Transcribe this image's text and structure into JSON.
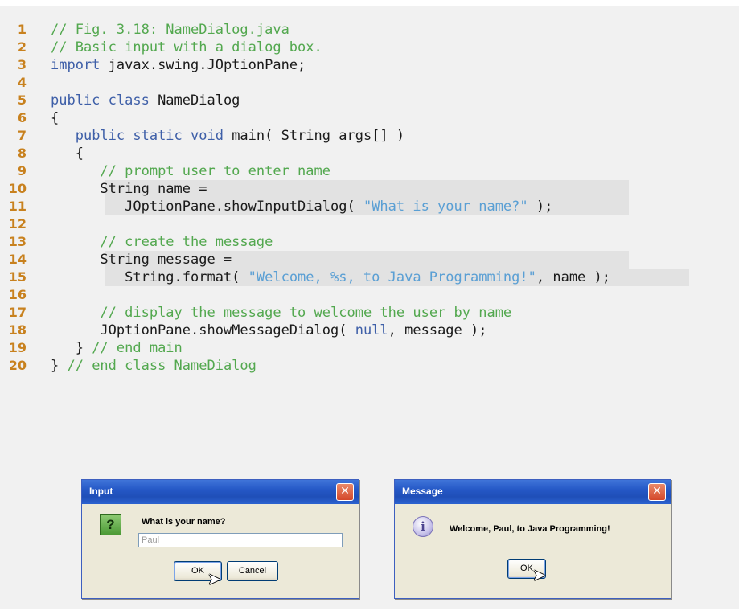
{
  "code": [
    {
      "n": "1",
      "tokens": [
        {
          "t": "// Fig. 3.18: NameDialog.java",
          "c": "cm"
        }
      ]
    },
    {
      "n": "2",
      "tokens": [
        {
          "t": "// Basic input with a dialog box.",
          "c": "cm"
        }
      ]
    },
    {
      "n": "3",
      "tokens": [
        {
          "t": "import",
          "c": "kw"
        },
        {
          "t": " javax.swing.JOptionPane;",
          "c": ""
        }
      ]
    },
    {
      "n": "4",
      "tokens": []
    },
    {
      "n": "5",
      "tokens": [
        {
          "t": "public class",
          "c": "kw"
        },
        {
          "t": " NameDialog",
          "c": ""
        }
      ]
    },
    {
      "n": "6",
      "tokens": [
        {
          "t": "{",
          "c": ""
        }
      ]
    },
    {
      "n": "7",
      "tokens": [
        {
          "t": "   ",
          "c": ""
        },
        {
          "t": "public static void",
          "c": "kw"
        },
        {
          "t": " main( String args[] )",
          "c": ""
        }
      ]
    },
    {
      "n": "8",
      "tokens": [
        {
          "t": "   {",
          "c": ""
        }
      ]
    },
    {
      "n": "9",
      "tokens": [
        {
          "t": "      ",
          "c": ""
        },
        {
          "t": "// prompt user to enter name",
          "c": "cm"
        }
      ]
    },
    {
      "n": "10",
      "hl": true,
      "tokens": [
        {
          "t": "      String name =",
          "c": ""
        }
      ]
    },
    {
      "n": "11",
      "hl": true,
      "tokens": [
        {
          "t": "         JOptionPane.showInputDialog( ",
          "c": ""
        },
        {
          "t": "\"What is your name?\"",
          "c": "st"
        },
        {
          "t": " );",
          "c": ""
        }
      ]
    },
    {
      "n": "12",
      "tokens": []
    },
    {
      "n": "13",
      "tokens": [
        {
          "t": "      ",
          "c": ""
        },
        {
          "t": "// create the message",
          "c": "cm"
        }
      ]
    },
    {
      "n": "14",
      "hl": true,
      "tokens": [
        {
          "t": "      String message =",
          "c": ""
        }
      ]
    },
    {
      "n": "15",
      "hl": true,
      "tokens": [
        {
          "t": "         String.format( ",
          "c": ""
        },
        {
          "t": "\"Welcome, %s, to Java Programming!\"",
          "c": "st"
        },
        {
          "t": ", name );",
          "c": ""
        }
      ]
    },
    {
      "n": "16",
      "tokens": []
    },
    {
      "n": "17",
      "tokens": [
        {
          "t": "      ",
          "c": ""
        },
        {
          "t": "// display the message to welcome the user by name",
          "c": "cm"
        }
      ]
    },
    {
      "n": "18",
      "tokens": [
        {
          "t": "      JOptionPane.showMessageDialog( ",
          "c": ""
        },
        {
          "t": "null",
          "c": "kw"
        },
        {
          "t": ", message );",
          "c": ""
        }
      ]
    },
    {
      "n": "19",
      "tokens": [
        {
          "t": "   } ",
          "c": ""
        },
        {
          "t": "// end main",
          "c": "cm"
        }
      ]
    },
    {
      "n": "20",
      "tokens": [
        {
          "t": "} ",
          "c": ""
        },
        {
          "t": "// end class NameDialog",
          "c": "cm"
        }
      ]
    }
  ],
  "input_dialog": {
    "title": "Input",
    "close": "✕",
    "icon_glyph": "?",
    "prompt": "What is your name?",
    "field_value": "Paul",
    "ok_label": "OK",
    "cancel_label": "Cancel"
  },
  "message_dialog": {
    "title": "Message",
    "close": "✕",
    "icon_glyph": "i",
    "message": "Welcome, Paul, to Java Programming!",
    "ok_label": "OK"
  },
  "colors": {
    "line_number": "#c8811e",
    "comment": "#53a84f",
    "keyword": "#3e5fa8",
    "string": "#5a9fd4",
    "highlight": "#e2e2e2"
  }
}
